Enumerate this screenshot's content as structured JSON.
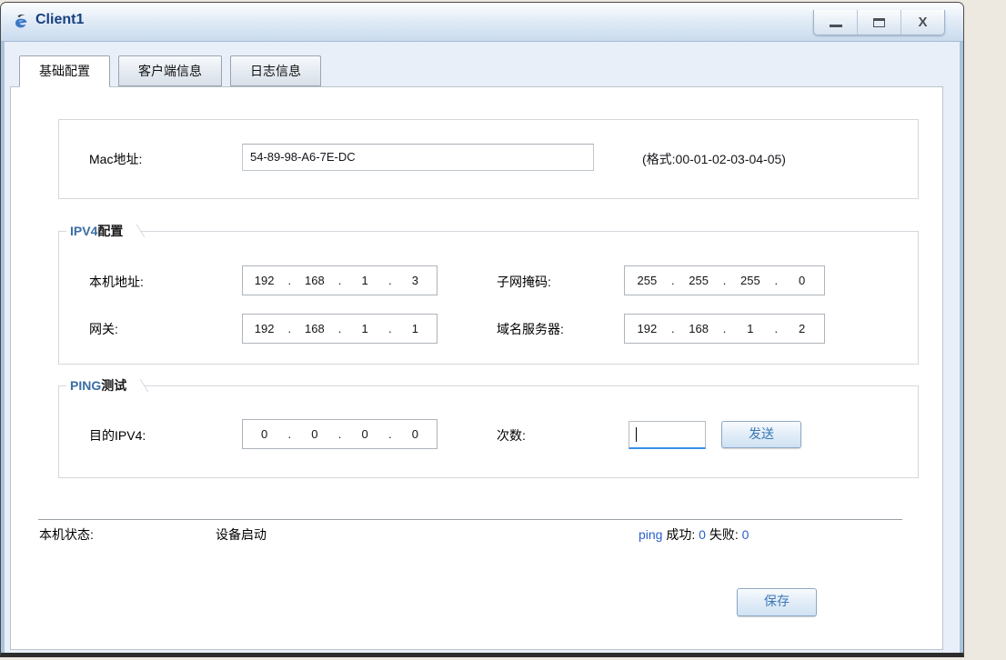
{
  "window": {
    "title": "Client1",
    "controls": {
      "close_glyph": "X"
    }
  },
  "tabs": [
    {
      "label": "基础配置",
      "active": true
    },
    {
      "label": "客户端信息",
      "active": false
    },
    {
      "label": "日志信息",
      "active": false
    }
  ],
  "mac_section": {
    "label": "Mac地址:",
    "value": "54-89-98-A6-7E-DC",
    "hint": "(格式:00-01-02-03-04-05)"
  },
  "ip_separator": ".",
  "ipv4_section": {
    "title_prefix": "IPV4",
    "title_suffix": "配置",
    "local": {
      "label": "本机地址:",
      "octets": [
        "192",
        "168",
        "1",
        "3"
      ]
    },
    "mask": {
      "label": "子网掩码:",
      "octets": [
        "255",
        "255",
        "255",
        "0"
      ]
    },
    "gateway": {
      "label": "网关:",
      "octets": [
        "192",
        "168",
        "1",
        "1"
      ]
    },
    "dns": {
      "label": "域名服务器:",
      "octets": [
        "192",
        "168",
        "1",
        "2"
      ]
    }
  },
  "ping_section": {
    "title_prefix": "PING",
    "title_suffix": "测试",
    "dest": {
      "label": "目的IPV4:",
      "octets": [
        "0",
        "0",
        "0",
        "0"
      ]
    },
    "count": {
      "label": "次数:",
      "value": ""
    },
    "send_button": "发送"
  },
  "status": {
    "label": "本机状态:",
    "value": "设备启动",
    "ping_word": "ping",
    "success_label": "成功:",
    "success_value": "0",
    "fail_label": "失败:",
    "fail_value": "0"
  },
  "save_button": "保存",
  "colors": {
    "accent_blue": "#3a78b5",
    "title_text": "#17407e",
    "status_number": "#2b5fcc",
    "desktop_background": "#EDE8E0"
  }
}
